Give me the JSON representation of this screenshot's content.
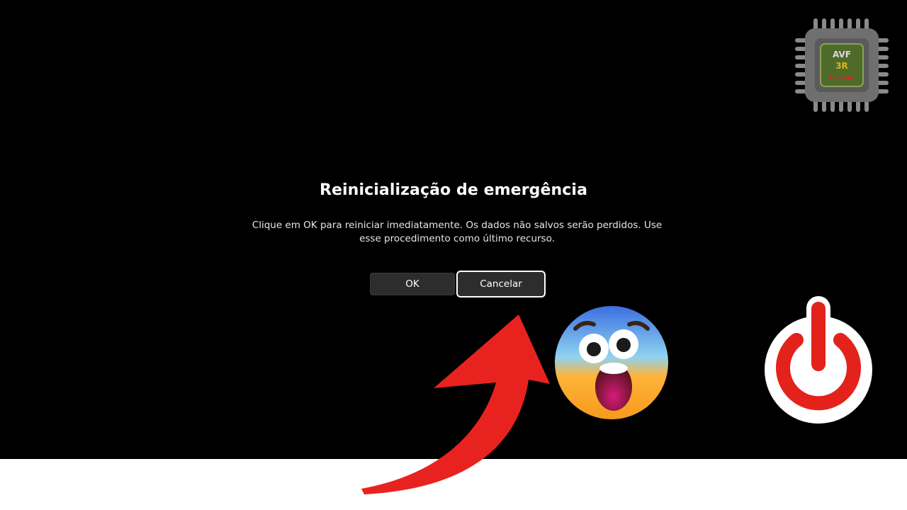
{
  "dialog": {
    "title": "Reinicialização de emergência",
    "message": "Clique em OK para reiniciar imediatamente. Os dados não salvos serão perdidos. Use esse procedimento como último recurso.",
    "buttons": {
      "ok_label": "OK",
      "cancel_label": "Cancelar"
    }
  },
  "overlay": {
    "chip_logo": {
      "icon": "cpu-chip-icon",
      "text_top": "AVF",
      "text_mid": "3R",
      "text_bottom": "10.0GHz"
    },
    "arrow": {
      "icon": "red-curved-arrow-icon",
      "color": "#e8231f"
    },
    "emoji": {
      "icon": "shocked-face-emoji-icon"
    },
    "power": {
      "icon": "power-icon",
      "color": "#e3231b"
    }
  },
  "colors": {
    "screen_background": "#000000",
    "button_background": "#2d2d2d",
    "focus_outline": "#ffffff",
    "bottom_strip": "#ffffff"
  }
}
